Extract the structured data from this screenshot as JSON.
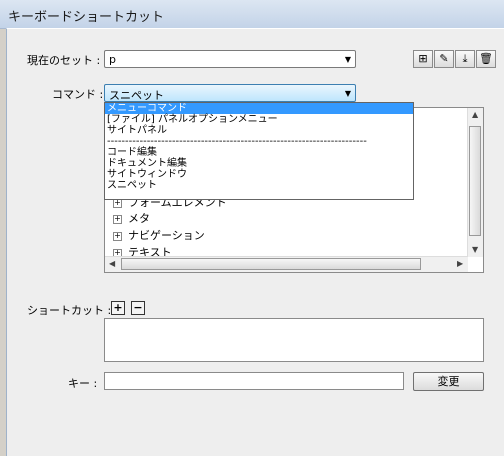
{
  "window": {
    "title": "キーボードショートカット"
  },
  "set_row": {
    "label": "現在のセット :",
    "value": "p",
    "buttons": [
      {
        "name": "duplicate-set-button",
        "glyph": "⊞"
      },
      {
        "name": "rename-set-button",
        "glyph": "✎"
      },
      {
        "name": "export-set-button",
        "glyph": "⤓"
      },
      {
        "name": "delete-set-button",
        "glyph": "🗑"
      }
    ]
  },
  "command_row": {
    "label": "コマンド :",
    "value": "スニペット"
  },
  "command_dropdown": {
    "options": [
      {
        "label": "メニューコマンド",
        "selected": true
      },
      {
        "label": "[ファイル] パネルオプションメニュー",
        "selected": false
      },
      {
        "label": "サイトパネル",
        "selected": false
      },
      {
        "label": "------------------------------------------------------------------------",
        "separator": true
      },
      {
        "label": "コード編集",
        "selected": false
      },
      {
        "label": "ドキュメント編集",
        "selected": false
      },
      {
        "label": "サイトウィンドウ",
        "selected": false
      },
      {
        "label": "スニペット",
        "selected": false
      }
    ]
  },
  "tree": {
    "items": [
      "フォームエレメント",
      "メタ",
      "ナビゲーション",
      "テキスト"
    ]
  },
  "shortcut_row": {
    "label": "ショートカット :",
    "add_glyph": "+",
    "remove_glyph": "−"
  },
  "key_row": {
    "label": "キー :",
    "value": "",
    "change_label": "変更"
  }
}
